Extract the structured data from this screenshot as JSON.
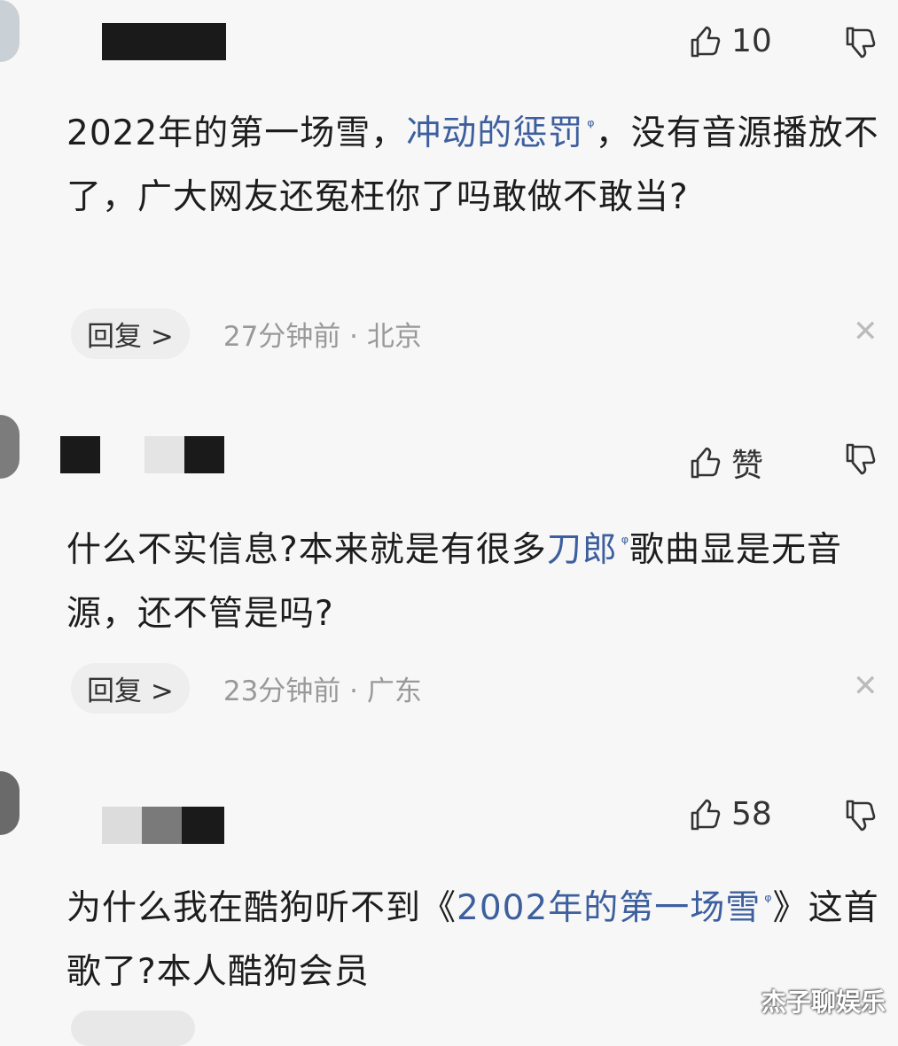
{
  "comments": [
    {
      "likes": "10",
      "text_before": "2022年的第一场雪，",
      "link": "冲动的惩罚",
      "text_after": "，没有音源播放不了，广大网友还冤枉你了吗敢做不敢当?",
      "reply_label": "回复 >",
      "time_location": "27分钟前 · 北京"
    },
    {
      "likes": "赞",
      "text_before": "什么不实信息?本来就是有很多",
      "link": "刀郎",
      "text_after": "歌曲显是无音源，还不管是吗?",
      "reply_label": "回复 >",
      "time_location": "23分钟前 · 广东"
    },
    {
      "likes": "58",
      "text_before": "为什么我在酷狗听不到《",
      "link": "2002年的第一场雪",
      "text_after": "》这首歌了?本人酷狗会员",
      "reply_label": "",
      "time_location": ""
    }
  ],
  "close_symbol": "✕",
  "search_symbol": "ᵠ",
  "watermark": "杰子聊娱乐",
  "colors": {
    "link": "#3d5f9e",
    "meta": "#999999",
    "background": "#f7f7f7"
  },
  "icons": [
    "thumbs-up-icon",
    "thumbs-down-icon",
    "close-icon",
    "search-icon"
  ]
}
